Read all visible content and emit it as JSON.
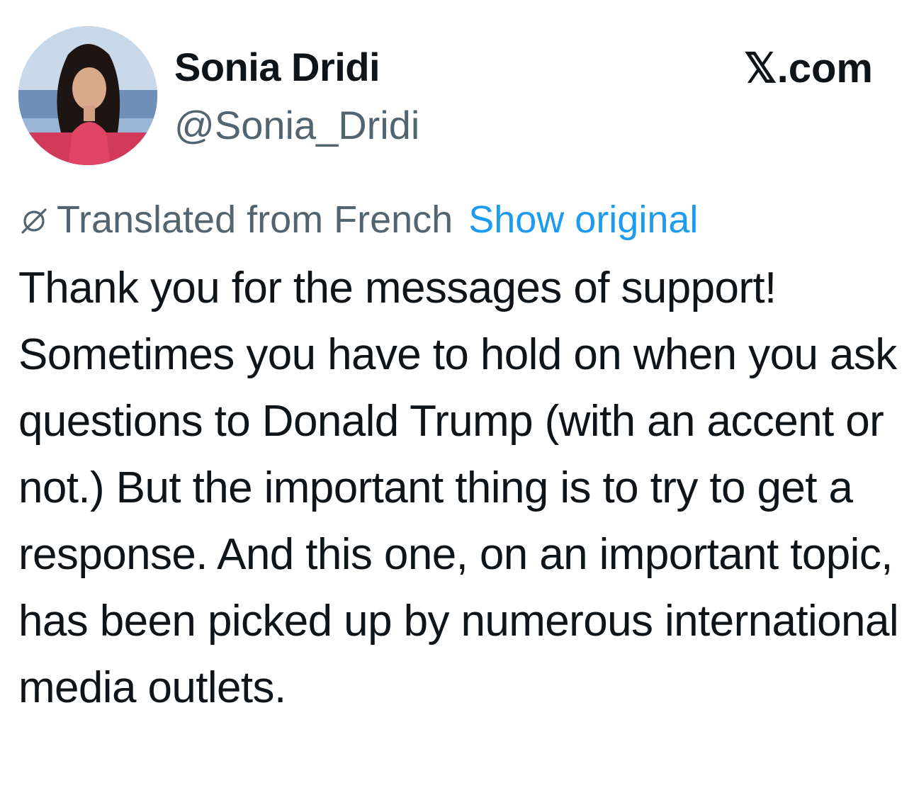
{
  "author": {
    "display_name": "Sonia Dridi",
    "handle": "@Sonia_Dridi"
  },
  "brand": {
    "label": "𝕏.com"
  },
  "translation": {
    "icon": "translate-icon",
    "label": "Translated from French",
    "show_original": "Show original"
  },
  "tweet": {
    "text": "Thank you for the messages of support! Sometimes you have to hold on when you ask questions to Donald Trump (with an accent or not.) But the important thing is to try to get a response. And this one, on an important topic, has been picked up by numerous international media outlets."
  },
  "colors": {
    "text_primary": "#0f1419",
    "text_secondary": "#536471",
    "link": "#1d9bf0"
  }
}
